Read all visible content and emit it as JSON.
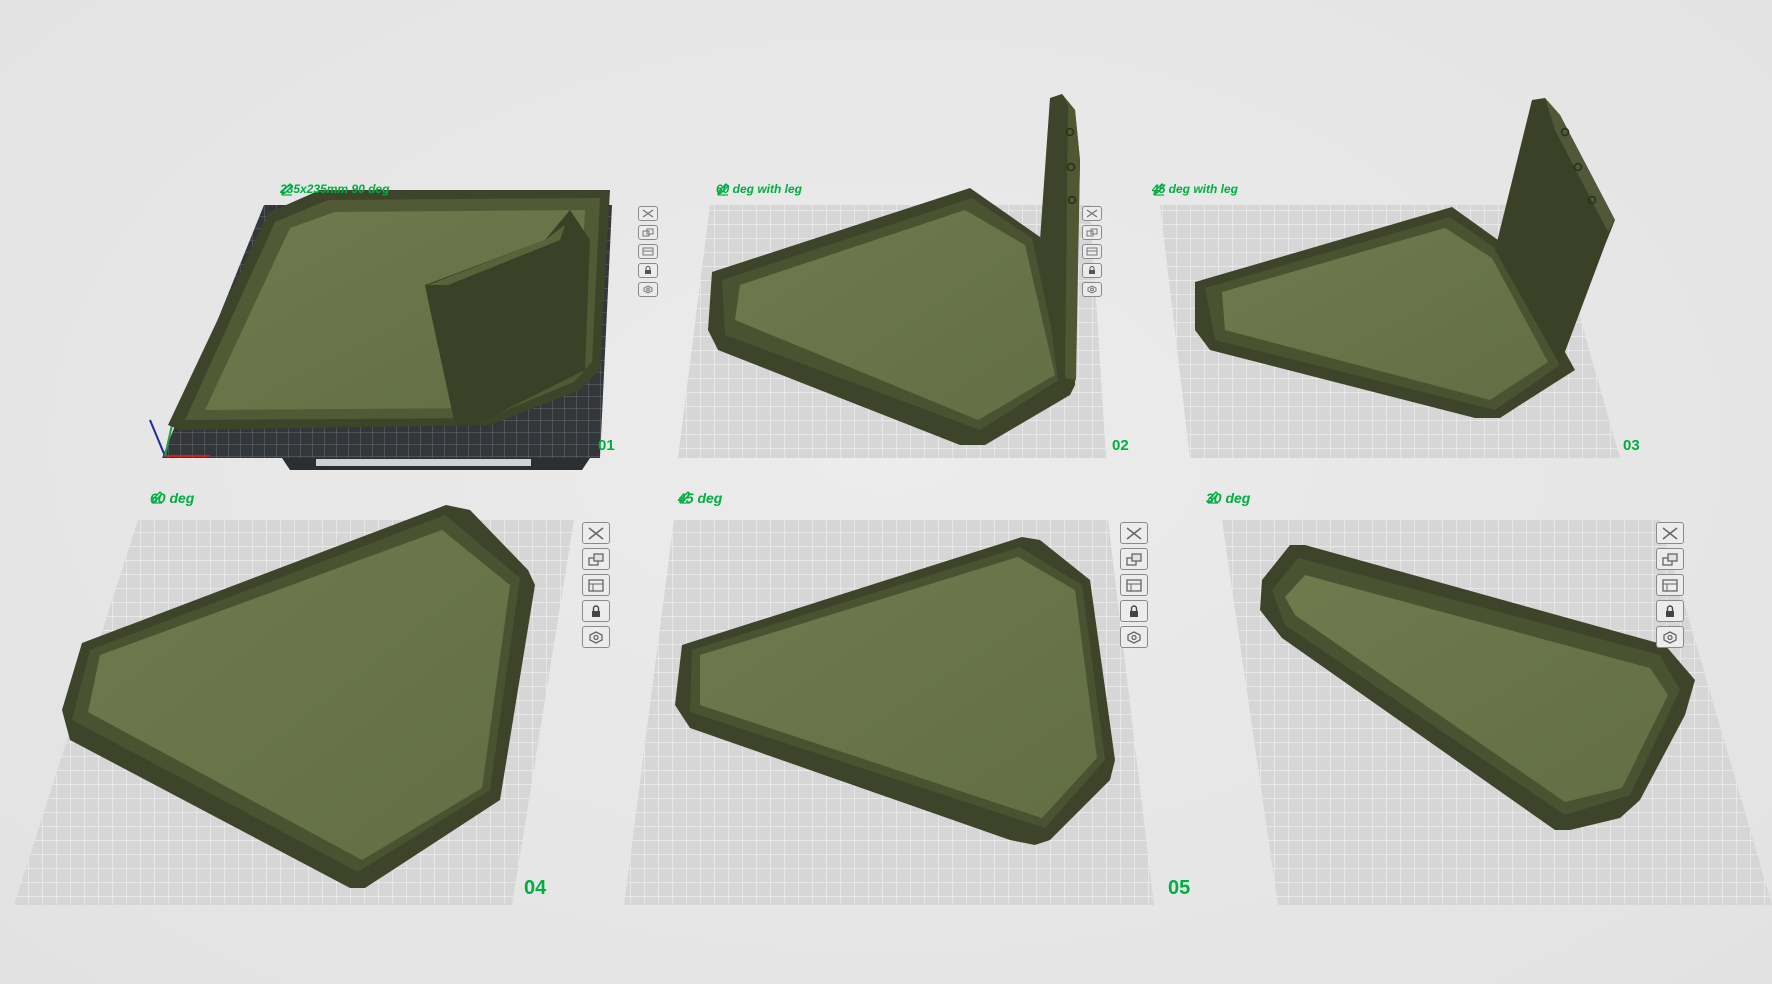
{
  "plates": [
    {
      "name": "235x235mm 90 deg",
      "number": "01"
    },
    {
      "name": "60 deg with leg",
      "number": "02"
    },
    {
      "name": "45 deg with leg",
      "number": "03"
    },
    {
      "name": "60 deg",
      "number": "04"
    },
    {
      "name": "45 deg",
      "number": "05"
    },
    {
      "name": "30 deg",
      "number": ""
    }
  ],
  "plate_tools": [
    "close-icon",
    "arrange-icon",
    "slice-plate-icon",
    "lock-icon",
    "settings-icon"
  ],
  "colors": {
    "accent": "#00ae42",
    "model_top": "#6a7549",
    "model_wall": "#3d4429",
    "plate_grid": "#d4d4d4",
    "background": "#e8e8e8"
  }
}
